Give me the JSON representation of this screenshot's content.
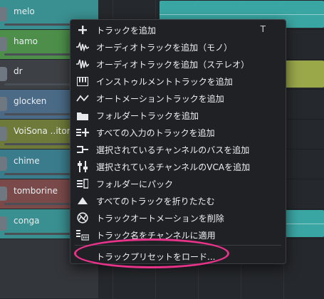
{
  "tracks": [
    {
      "name": "melo"
    },
    {
      "name": "hamo"
    },
    {
      "name": "dr"
    },
    {
      "name": "glocken"
    },
    {
      "name": "VoiSona ..itor"
    },
    {
      "name": "chime"
    },
    {
      "name": "tomborine"
    },
    {
      "name": "conga"
    }
  ],
  "menu": {
    "items": [
      {
        "icon": "plus-icon",
        "label": "トラックを追加",
        "shortcut": "T"
      },
      {
        "icon": "audio-mono-icon",
        "label": "オーディオトラックを追加（モノ）"
      },
      {
        "icon": "audio-stereo-icon",
        "label": "オーディオトラックを追加（ステレオ）"
      },
      {
        "icon": "piano-keys-icon",
        "label": "インストゥルメントトラックを追加"
      },
      {
        "icon": "automation-curve-icon",
        "label": "オートメーショントラックを追加"
      },
      {
        "icon": "folder-icon",
        "label": "フォルダートラックを追加"
      },
      {
        "icon": "add-all-inputs-icon",
        "label": "すべての入力のトラックを追加"
      },
      {
        "icon": "bus-icon",
        "label": "選択されているチャンネルのバスを追加"
      },
      {
        "icon": "vca-icon",
        "label": "選択されているチャンネルのVCAを追加"
      },
      {
        "icon": "pack-folder-icon",
        "label": "フォルダーにパック"
      },
      {
        "icon": "collapse-triangle-icon",
        "label": "すべてのトラックを折りたたむ"
      },
      {
        "icon": "remove-automation-icon",
        "label": "トラックオートメーションを削除"
      },
      {
        "icon": "apply-names-icon",
        "label": "トラック名をチャンネルに適用"
      },
      {
        "icon": "",
        "label": "トラックプリセットをロード..."
      }
    ]
  },
  "colors": {
    "menu_bg": "#1f2124",
    "highlight": "#e8338a",
    "clip_teal": "#3aa6a3",
    "clip_olive": "#9aa84a"
  }
}
